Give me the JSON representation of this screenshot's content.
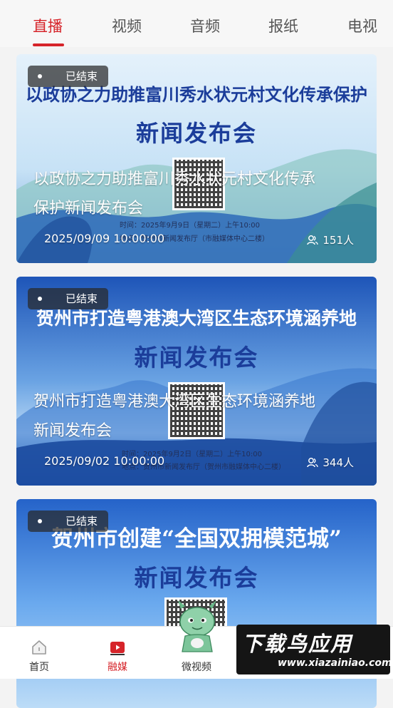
{
  "tabs": [
    "直播",
    "视频",
    "音频",
    "报纸",
    "电视"
  ],
  "cards": [
    {
      "badge": "已结束",
      "poster_title": "以政协之力助推富川秀水状元村文化传承保护",
      "poster_subtitle": "新闻发布会",
      "poster_time": "时间：2025年9月9日（星期二）上午10:00",
      "poster_venue": "地点：贺州市新闻发布厅（市融媒体中心二楼）",
      "title_line1": "以政协之力助推富川秀水状元村文化传承",
      "title_line2": "保护新闻发布会",
      "date": "2025/09/09 10:00:00",
      "viewers": "151人"
    },
    {
      "badge": "已结束",
      "poster_title": "贺州市打造粤港澳大湾区生态环境涵养地",
      "poster_subtitle": "新闻发布会",
      "poster_time": "时间：2025年9月2日（星期二）上午10:00",
      "poster_venue": "地点：贺州市新闻发布厅（贺州市融媒体中心二楼）",
      "title_line1": "贺州市打造粤港澳大湾区生态环境涵养地",
      "title_line2": "新闻发布会",
      "date": "2025/09/02 10:00:00",
      "viewers": "344人"
    },
    {
      "badge": "已结束",
      "poster_title": "贺州市创建“全国双拥模范城”",
      "poster_subtitle": "新闻发布会"
    }
  ],
  "bottom_nav": [
    "首页",
    "融媒",
    "微视频"
  ],
  "watermark": {
    "main": "下载鸟应用",
    "sub": "www.xiazainiao.com"
  },
  "colors": {
    "accent": "#d6242a",
    "poster_blue": "#1b3d9a"
  }
}
